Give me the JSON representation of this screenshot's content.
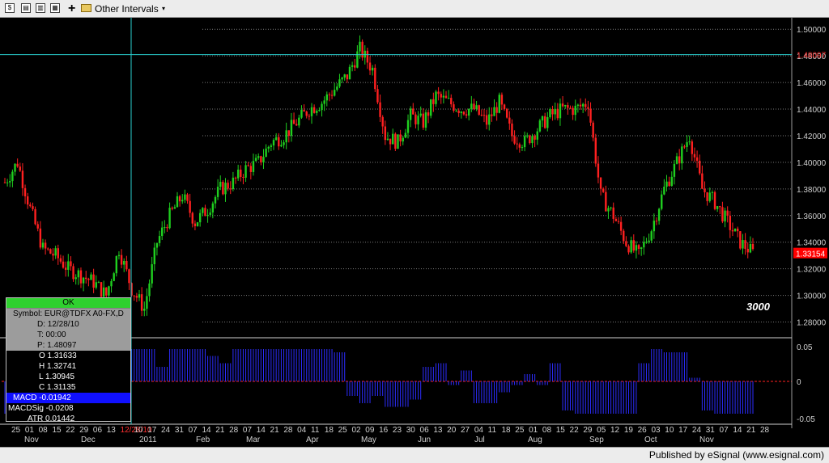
{
  "toolbar": {
    "interval_label": "Other Intervals",
    "interval_arrow": "▾",
    "plus": "+",
    "icons": [
      "usd-icon",
      "chart-icon",
      "chart-alt-icon",
      "properties-icon",
      "plus-icon",
      "folder-icon"
    ]
  },
  "chart_data": {
    "type": "candlestick",
    "symbol": "EUR@TDFX A0-FX,D",
    "price_axis_ticks": [
      "1.50000",
      "1.48000",
      "1.46000",
      "1.44000",
      "1.42000",
      "1.40000",
      "1.38000",
      "1.36000",
      "1.34000",
      "1.32000",
      "1.30000",
      "1.28000"
    ],
    "ylim": [
      1.27,
      1.505
    ],
    "crosshair_price": "1.48097",
    "last_price": "1.33154",
    "annotation": "3000",
    "macd_axis_ticks": [
      "0.05",
      "0",
      "-0.05"
    ],
    "date_labels": [
      "25",
      "01",
      "08",
      "15",
      "22",
      "29",
      "06",
      "13",
      "12/28/10",
      "10",
      "17",
      "24",
      "31",
      "07",
      "14",
      "21",
      "28",
      "07",
      "14",
      "21",
      "28",
      "04",
      "11",
      "18",
      "25",
      "02",
      "09",
      "16",
      "23",
      "30",
      "06",
      "13",
      "20",
      "27",
      "04",
      "11",
      "18",
      "25",
      "01",
      "08",
      "15",
      "22",
      "29",
      "05",
      "12",
      "19",
      "26",
      "03",
      "10",
      "17",
      "24",
      "31",
      "07",
      "14",
      "21",
      "28"
    ],
    "month_labels": [
      "Nov",
      "Dec",
      "2011",
      "Feb",
      "Mar",
      "Apr",
      "May",
      "Jun",
      "Jul",
      "Aug",
      "Sep",
      "Oct",
      "Nov"
    ],
    "closes_weekly": [
      1.385,
      1.4,
      1.365,
      1.335,
      1.33,
      1.32,
      1.315,
      1.31,
      1.3,
      1.335,
      1.305,
      1.29,
      1.34,
      1.36,
      1.375,
      1.355,
      1.365,
      1.38,
      1.385,
      1.395,
      1.4,
      1.415,
      1.42,
      1.43,
      1.44,
      1.445,
      1.455,
      1.465,
      1.485,
      1.47,
      1.42,
      1.415,
      1.435,
      1.43,
      1.45,
      1.445,
      1.44,
      1.44,
      1.43,
      1.445,
      1.42,
      1.415,
      1.425,
      1.435,
      1.44,
      1.44,
      1.445,
      1.375,
      1.36,
      1.34,
      1.33,
      1.35,
      1.38,
      1.4,
      1.42,
      1.38,
      1.37,
      1.355,
      1.34,
      1.332
    ],
    "colors": {
      "up": "#1fcf1f",
      "down": "#ff2020",
      "grid": "#7a7a7a",
      "crosshair": "#2ad0d0",
      "macd": "#2c2cff",
      "signal": "#ff2020",
      "price_label_bg": "#ff0000",
      "crosshair_label": "#ff3333"
    }
  },
  "data_window": {
    "ok": "OK",
    "symbol": "Symbol: EUR@TDFX A0-FX,D",
    "d": "D: 12/28/10",
    "t": "T: 00:00",
    "p": "P: 1.48097",
    "o": "O 1.31633",
    "h": "H 1.32741",
    "l": "L 1.30945",
    "c": "C 1.31135",
    "macd": "MACD -0.01942",
    "macdsig": "MACDSig -0.0208",
    "atr": "ATR 0.01442"
  },
  "footer": {
    "text": "Published by eSignal (www.esignal.com)"
  }
}
